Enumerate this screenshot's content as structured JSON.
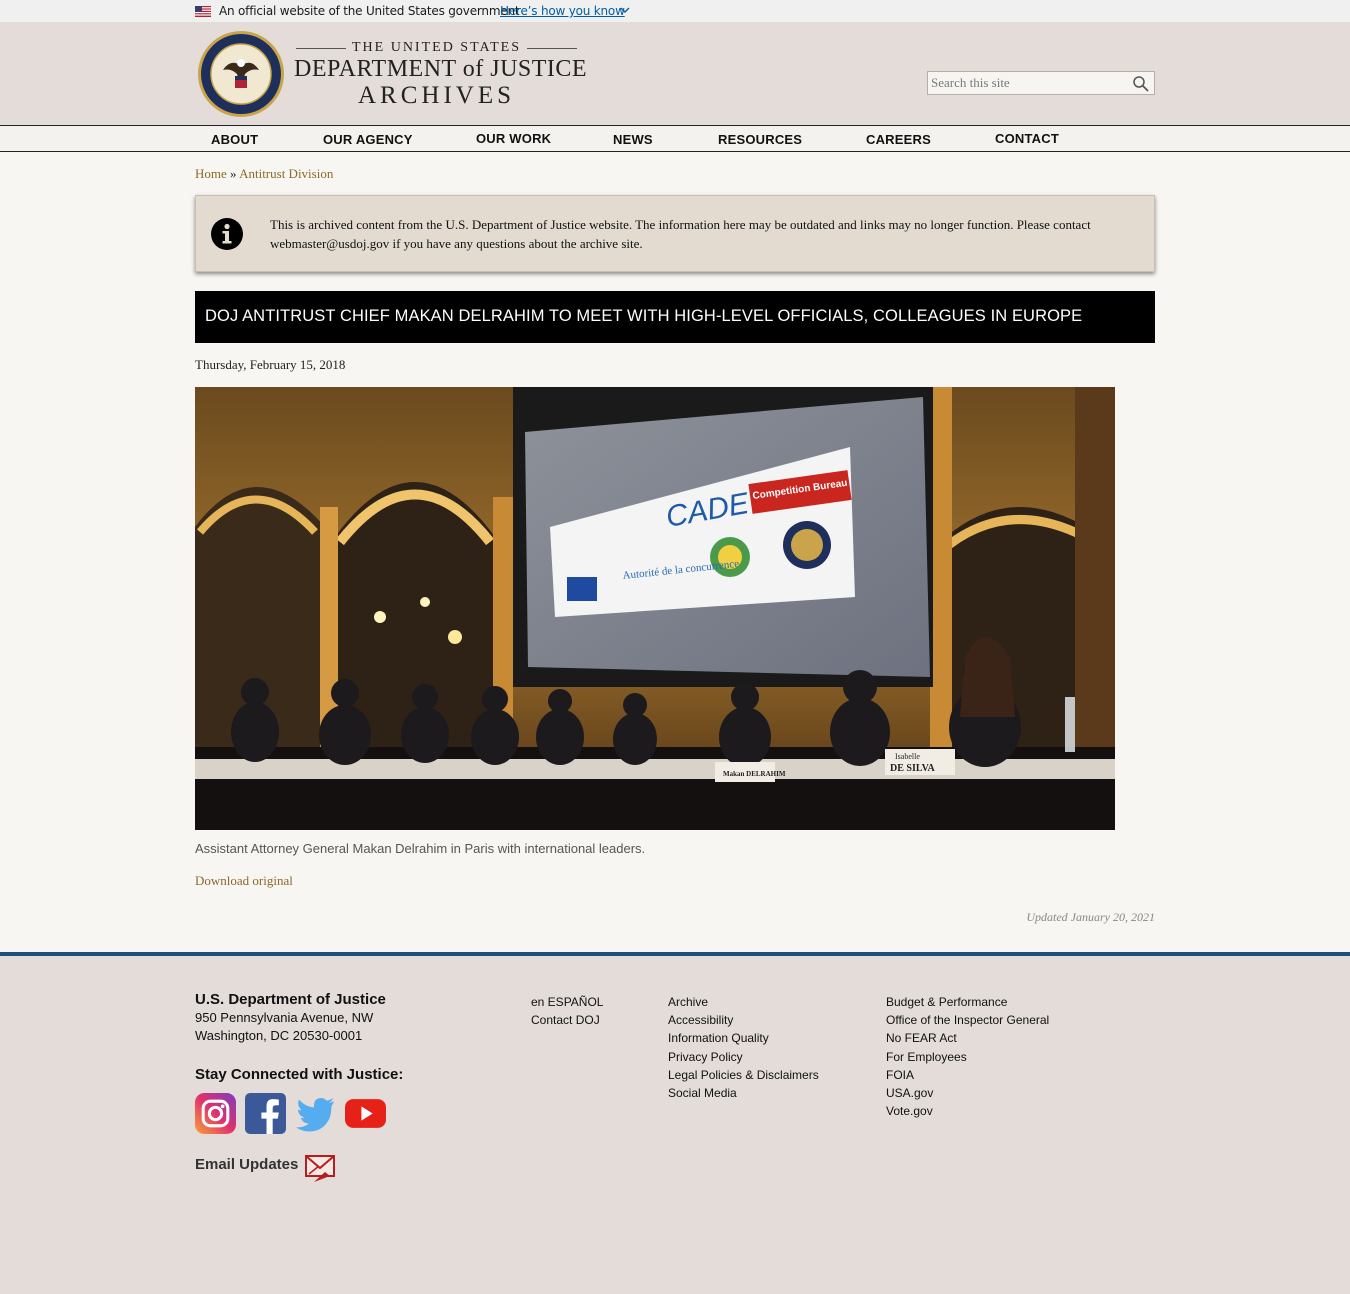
{
  "gov_banner": {
    "official_text": "An official website of the United States government",
    "how_link": "Here’s how you know"
  },
  "header": {
    "logo_line1": "THE UNITED STATES",
    "logo_line2": "DEPARTMENT of JUSTICE",
    "logo_line3": "ARCHIVES",
    "search_placeholder": "Search this site"
  },
  "nav": {
    "items": [
      "ABOUT",
      "OUR AGENCY",
      "OUR WORK",
      "NEWS",
      "RESOURCES",
      "CAREERS",
      "CONTACT"
    ]
  },
  "breadcrumb": {
    "home": "Home",
    "separator": "»",
    "current": "Antitrust Division"
  },
  "notice": {
    "text": "This is archived content from the U.S. Department of Justice website. The information here may be outdated and links may no longer function. Please contact webmaster@usdoj.gov if you have any questions about the archive site."
  },
  "article": {
    "title": "DOJ ANTITRUST CHIEF MAKAN DELRAHIM TO MEET WITH HIGH-LEVEL OFFICIALS, COLLEAGUES IN EUROPE",
    "date": "Thursday, February 15, 2018",
    "photo": {
      "screen_logo_text": "CADE",
      "screen_agency_text": "Competition Bureau",
      "screen_autorite": "Autorité de la concurrence",
      "nameplate_delrahim": "Makan DELRAHIM",
      "nameplate_desilva_1": "Isabelle",
      "nameplate_desilva_2": "DE SILVA"
    },
    "caption": "Assistant Attorney General Makan Delrahim in Paris with international leaders.",
    "download": "Download original",
    "updated": "Updated January 20, 2021"
  },
  "footer": {
    "org": "U.S. Department of Justice",
    "address1": "950 Pennsylvania Avenue, NW",
    "address2": "Washington, DC 20530-0001",
    "stay_connected": "Stay Connected with Justice:",
    "email_updates": "Email Updates",
    "col1": [
      "en ESPAÑOL",
      "Contact DOJ"
    ],
    "col2": [
      "Archive",
      "Accessibility",
      "Information Quality",
      "Privacy Policy",
      "Legal Policies & Disclaimers",
      "Social Media"
    ],
    "col3": [
      "Budget & Performance",
      "Office of the Inspector General",
      "No FEAR Act",
      "For Employees",
      "FOIA",
      "USA.gov",
      "Vote.gov"
    ]
  },
  "colors": {
    "link": "#8a6a2a",
    "title_bar": "#000000",
    "footer_rule": "#1f4e79",
    "gov_link": "#005ea2"
  }
}
